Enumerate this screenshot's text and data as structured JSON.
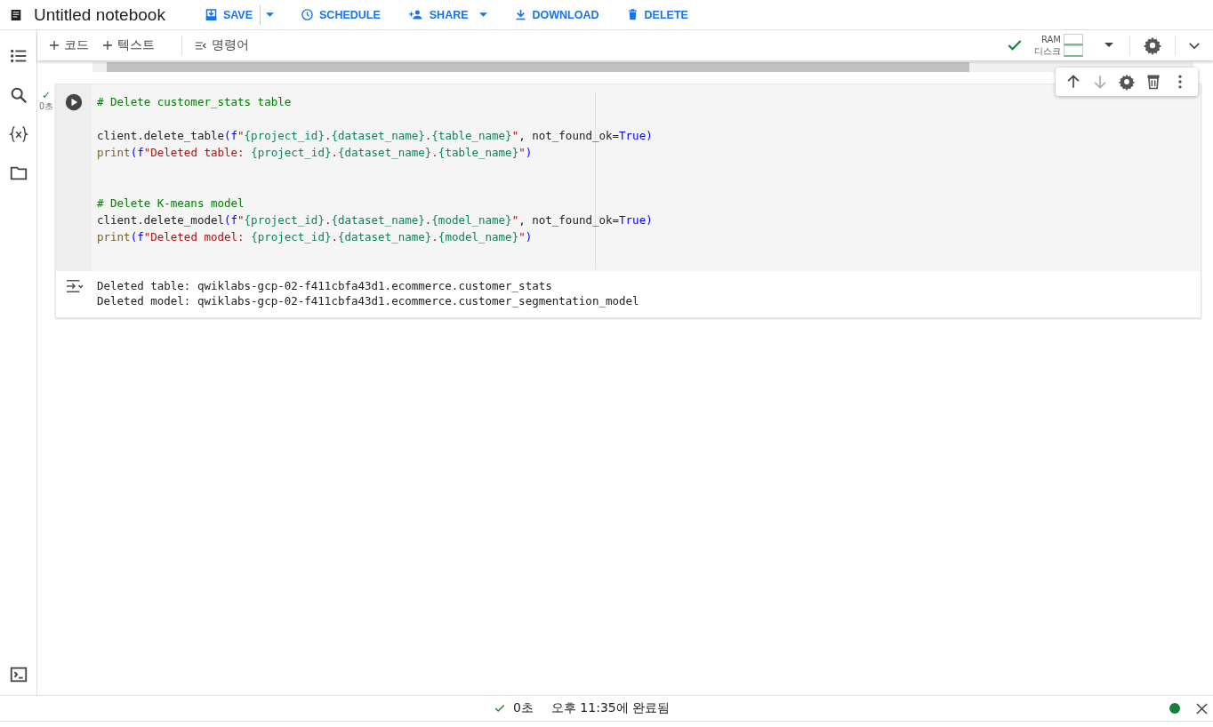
{
  "title": "Untitled notebook",
  "header_actions": [
    {
      "kind": "save",
      "label": "SAVE",
      "dropdown": true
    },
    {
      "kind": "schedule",
      "label": "SCHEDULE",
      "dropdown": false
    },
    {
      "kind": "share",
      "label": "SHARE",
      "dropdown": true
    },
    {
      "kind": "download",
      "label": "DOWNLOAD",
      "dropdown": false
    },
    {
      "kind": "delete",
      "label": "DELETE",
      "dropdown": false
    }
  ],
  "toolbar": {
    "add_code": "코드",
    "add_text": "텍스트",
    "commands": "명령어",
    "ram_label": "RAM",
    "disk_label": "디스크"
  },
  "cell": {
    "status_mark": "✓",
    "duration": "0초",
    "blocks": [
      [
        [
          {
            "kind": "comment",
            "text": "# Delete customer_stats table"
          }
        ]
      ],
      [
        [
          {
            "kind": "plain",
            "text": "client.delete_table"
          },
          {
            "kind": "paren",
            "text": "("
          },
          {
            "kind": "paren",
            "text": "f"
          },
          {
            "kind": "string",
            "text": "\""
          },
          {
            "kind": "brace",
            "text": "{project_id}"
          },
          {
            "kind": "string",
            "text": "."
          },
          {
            "kind": "brace",
            "text": "{dataset_name}"
          },
          {
            "kind": "string",
            "text": "."
          },
          {
            "kind": "brace",
            "text": "{table_name}"
          },
          {
            "kind": "string",
            "text": "\""
          },
          {
            "kind": "plain",
            "text": ", not_found_ok="
          },
          {
            "kind": "paren",
            "text": "True"
          },
          {
            "kind": "paren",
            "text": ")"
          }
        ],
        [
          {
            "kind": "builtin",
            "text": "print"
          },
          {
            "kind": "paren",
            "text": "("
          },
          {
            "kind": "paren",
            "text": "f"
          },
          {
            "kind": "string",
            "text": "\"Deleted table: "
          },
          {
            "kind": "brace",
            "text": "{project_id}"
          },
          {
            "kind": "string",
            "text": "."
          },
          {
            "kind": "brace",
            "text": "{dataset_name}"
          },
          {
            "kind": "string",
            "text": "."
          },
          {
            "kind": "brace",
            "text": "{table_name}"
          },
          {
            "kind": "string",
            "text": "\""
          },
          {
            "kind": "paren",
            "text": ")"
          }
        ]
      ],
      [
        [
          {
            "kind": "comment",
            "text": "# Delete K-means model"
          }
        ],
        [
          {
            "kind": "plain",
            "text": "client.delete_model"
          },
          {
            "kind": "paren",
            "text": "("
          },
          {
            "kind": "paren",
            "text": "f"
          },
          {
            "kind": "string",
            "text": "\""
          },
          {
            "kind": "brace",
            "text": "{project_id}"
          },
          {
            "kind": "string",
            "text": "."
          },
          {
            "kind": "brace",
            "text": "{dataset_name}"
          },
          {
            "kind": "string",
            "text": "."
          },
          {
            "kind": "brace",
            "text": "{model_name}"
          },
          {
            "kind": "string",
            "text": "\""
          },
          {
            "kind": "plain",
            "text": ", not_found_ok="
          },
          {
            "kind": "paren",
            "text": "True"
          },
          {
            "kind": "paren",
            "text": ")"
          }
        ],
        [
          {
            "kind": "builtin",
            "text": "print"
          },
          {
            "kind": "paren",
            "text": "("
          },
          {
            "kind": "paren",
            "text": "f"
          },
          {
            "kind": "string",
            "text": "\"Deleted model: "
          },
          {
            "kind": "brace",
            "text": "{project_id}"
          },
          {
            "kind": "string",
            "text": "."
          },
          {
            "kind": "brace",
            "text": "{dataset_name}"
          },
          {
            "kind": "string",
            "text": "."
          },
          {
            "kind": "brace",
            "text": "{model_name}"
          },
          {
            "kind": "string",
            "text": "\""
          },
          {
            "kind": "paren",
            "text": ")"
          }
        ]
      ]
    ],
    "output": [
      "Deleted table: qwiklabs-gcp-02-f411cbfa43d1.ecommerce.customer_stats",
      "Deleted model: qwiklabs-gcp-02-f411cbfa43d1.ecommerce.customer_segmentation_model"
    ]
  },
  "status_bar": {
    "duration": "0초",
    "completed": "오후 11:35에 완료됨"
  }
}
